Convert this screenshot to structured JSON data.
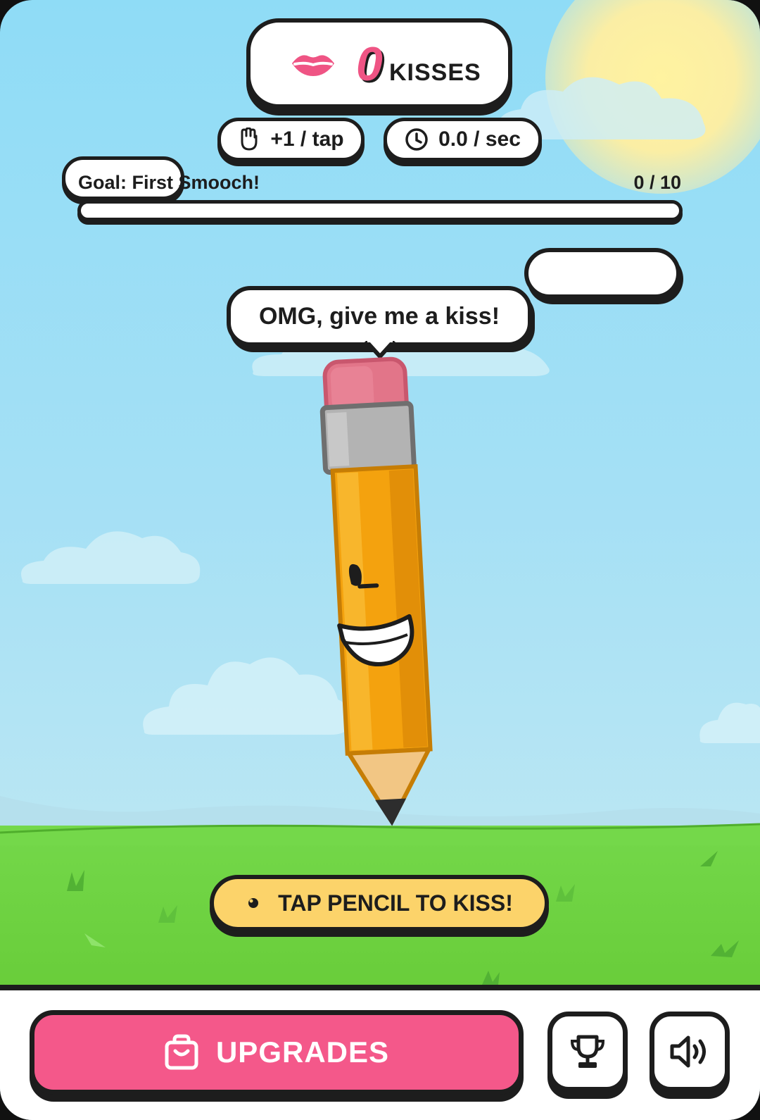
{
  "score": {
    "count": "0",
    "label": "KISSES",
    "icon": "lips-icon",
    "count_color": "#ef5484"
  },
  "stats": {
    "per_tap": {
      "label": "+1 / tap",
      "icon": "hand-icon"
    },
    "per_sec": {
      "label": "0.0 / sec",
      "icon": "clock-icon"
    }
  },
  "goal": {
    "label": "Goal: First Smooch!",
    "progress_text": "0 / 10",
    "current": 0,
    "target": 10,
    "fill_color": "#ef5484"
  },
  "speech": {
    "text": "OMG, give me a kiss!"
  },
  "character": {
    "name": "pencil-character",
    "winking": true,
    "smiling": true
  },
  "tap_hint": {
    "label": "TAP PENCIL TO KISS!",
    "icon": "pointer-dot-icon",
    "color": "#fcd36a"
  },
  "bottom_bar": {
    "upgrades": {
      "label": "UPGRADES",
      "icon": "shopping-bag-icon",
      "color": "#f4588a"
    },
    "achievements": {
      "icon": "trophy-icon"
    },
    "sound": {
      "icon": "speaker-volume-icon"
    }
  },
  "colors": {
    "sky": "#8fdcf6",
    "grass": "#6ccf3d",
    "outline": "#1d1d1d",
    "pink": "#ef5484",
    "yellow": "#fcd36a"
  }
}
